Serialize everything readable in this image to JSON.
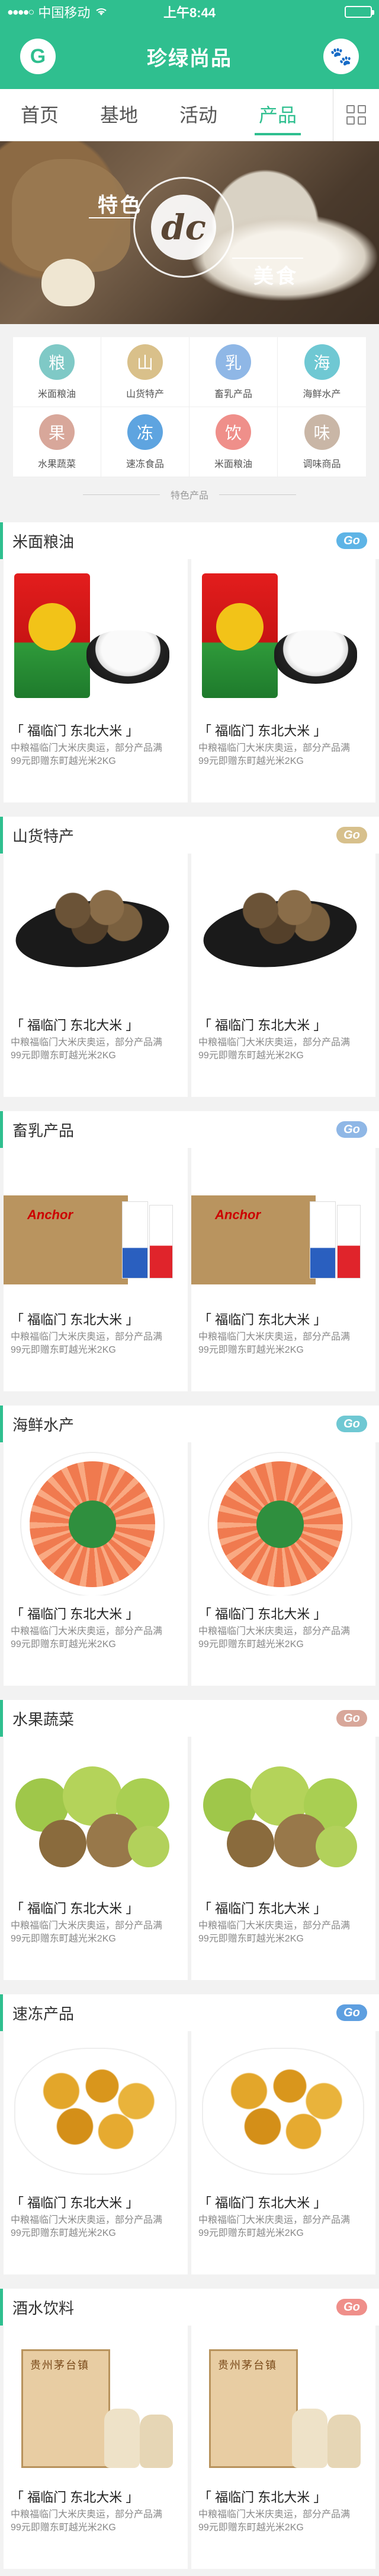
{
  "status_bar": {
    "carrier": "中国移动",
    "time": "上午8:44",
    "battery_level": 0.85
  },
  "header": {
    "logo_letter": "G",
    "title": "珍绿尚品",
    "paw_glyph": "🐾"
  },
  "nav": {
    "tabs": [
      "首页",
      "基地",
      "活动",
      "产品"
    ],
    "active_tab": "产品"
  },
  "banner": {
    "word1": "特色",
    "emblem": "dc",
    "word2": "美食"
  },
  "categories": [
    {
      "glyph": "粮",
      "label": "米面粮油",
      "color": "#7fc9c6"
    },
    {
      "glyph": "山",
      "label": "山货特产",
      "color": "#d9c08a"
    },
    {
      "glyph": "乳",
      "label": "畜乳产品",
      "color": "#8fb7e6"
    },
    {
      "glyph": "海",
      "label": "海鲜水产",
      "color": "#6fc8d3"
    },
    {
      "glyph": "果",
      "label": "水果蔬菜",
      "color": "#d8a79a"
    },
    {
      "glyph": "冻",
      "label": "速冻食品",
      "color": "#5ea4e0"
    },
    {
      "glyph": "饮",
      "label": "米面粮油",
      "color": "#ef8f8a"
    },
    {
      "glyph": "味",
      "label": "调味商品",
      "color": "#c9b6a6"
    }
  ],
  "category_footer": "特色产品",
  "sections": [
    {
      "name": "米面粮油",
      "go": "Go",
      "go_color": "#5eb4e6"
    },
    {
      "name": "山货特产",
      "go": "Go",
      "go_color": "#d7c08c"
    },
    {
      "name": "畜乳产品",
      "go": "Go",
      "go_color": "#8fb7e6"
    },
    {
      "name": "海鲜水产",
      "go": "Go",
      "go_color": "#6fc8d3"
    },
    {
      "name": "水果蔬菜",
      "go": "Go",
      "go_color": "#d8a79a"
    },
    {
      "name": "速冻产品",
      "go": "Go",
      "go_color": "#5e9fe0"
    },
    {
      "name": "酒水饮料",
      "go": "Go",
      "go_color": "#ef8f8a"
    }
  ],
  "product": {
    "name": "「 福临门 东北大米 」",
    "desc1": "中粮福临门大米庆奥运，部分产品满",
    "desc2": "99元即赠东町越光米2KG"
  },
  "colors": {
    "brand": "#2fbf8f"
  }
}
